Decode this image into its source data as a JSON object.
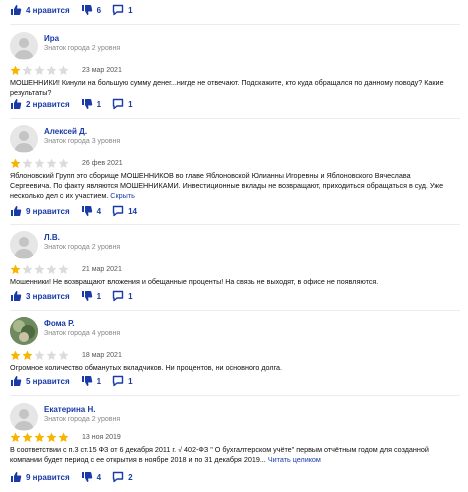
{
  "top_actions": {
    "likes": "4 нравится",
    "dislikes": "6",
    "comments": "1"
  },
  "reviews": [
    {
      "name": "Ира",
      "rank": "Знаток города 2 уровня",
      "rating": 1,
      "date": "23 мар 2021",
      "text": "МОШЕННИКИ! Кинули на большую сумму денег...нигде не отвечают. Подскажите, кто куда обращался по данному поводу? Какие результаты?",
      "more": "",
      "likes": "2 нравится",
      "dislikes": "1",
      "comments": "1"
    },
    {
      "name": "Алексей Д.",
      "rank": "Знаток города 3 уровня",
      "rating": 1,
      "date": "26 фев 2021",
      "text": "Яблоновский Групп это сборище МОШЕННИКОВ во главе Яблоновской Юлианны Игоревны и Яблоновского Вячеслава Сергеевича. По факту являются МОШЕННИКАМИ. Инвестиционные вклады не возвращают, приходиться обращаться в суд. Уже несколько дел с их участием.",
      "more": "Скрыть",
      "likes": "9 нравится",
      "dislikes": "4",
      "comments": "14"
    },
    {
      "name": "Л.В.",
      "rank": "Знаток города 2 уровня",
      "rating": 1,
      "date": "21 мар 2021",
      "text": "Мошенники! Не возвращают вложения и обещанные проценты! На связь не выходят, в офисе не появляются.",
      "more": "",
      "likes": "3 нравится",
      "dislikes": "1",
      "comments": "1"
    },
    {
      "name": "Фома Р.",
      "rank": "Знаток города 4 уровня",
      "rating": 2,
      "date": "18 мар 2021",
      "text": "Огромное количество обманутых вкладчиков. Ни процентов, ни основного долга.",
      "more": "",
      "likes": "5 нравится",
      "dislikes": "1",
      "comments": "1"
    },
    {
      "name": "Екатерина Н.",
      "rank": "Знаток города 2 уровня",
      "rating": 5,
      "date": "13 ноя 2019",
      "text": "В соответствии с п.3 ст.15 ФЗ от 6 декабря 2011 г. √ 402-ФЗ \" О бухгалтерском учёте\" первым отчётным годом для созданной компании будет период с ее открытия в ноябре 2018 и по 31 декабря 2019...",
      "more": "Читать целиком",
      "likes": "9 нравится",
      "dislikes": "4",
      "comments": "2"
    }
  ],
  "colors": {
    "link": "#1a3aa8",
    "star_on": "#f7b500",
    "star_off": "#dcdcdc"
  },
  "icons": {
    "like": "thumbs-up-icon",
    "dislike": "thumbs-down-icon",
    "comment": "comment-icon",
    "star": "star-icon"
  }
}
